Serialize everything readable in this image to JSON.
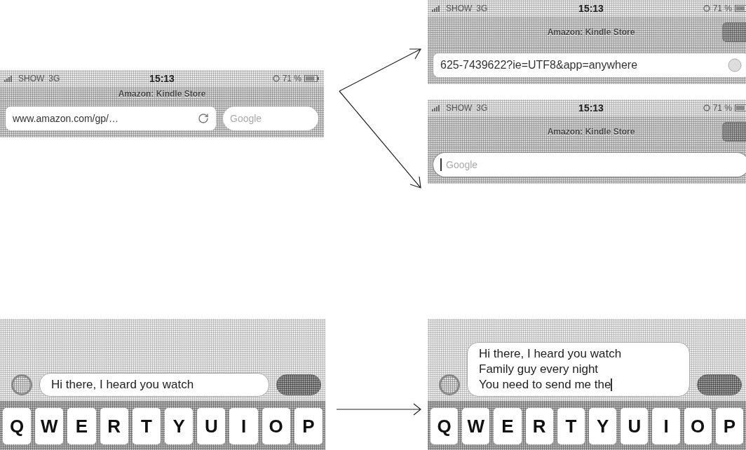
{
  "browsers": [
    {
      "kind": "split",
      "status": {
        "carrier": "SHOW",
        "network": "3G",
        "time": "15:13",
        "battery": "71 %"
      },
      "title": "Amazon: Kindle Store",
      "address": "www.amazon.com/gp/…",
      "search_placeholder": "Google",
      "search_focused": false
    },
    {
      "kind": "address",
      "status": {
        "carrier": "SHOW",
        "network": "3G",
        "time": "15:13",
        "battery": "71 %"
      },
      "title": "Amazon: Kindle Store",
      "address": "625-7439622?ie=UTF8&app=anywhere"
    },
    {
      "kind": "search",
      "status": {
        "carrier": "SHOW",
        "network": "3G",
        "time": "15:13",
        "battery": "71 %"
      },
      "title": "Amazon: Kindle Store",
      "search_placeholder": "Google",
      "search_focused": true
    }
  ],
  "composers": [
    {
      "lines": [
        "Hi there, I heard you watch"
      ],
      "cursor": false,
      "keys": [
        "Q",
        "W",
        "E",
        "R",
        "T",
        "Y",
        "U",
        "I",
        "O",
        "P"
      ]
    },
    {
      "lines": [
        "Hi there, I heard you watch",
        "Family guy every night",
        "You need to send me the"
      ],
      "cursor": true,
      "keys": [
        "Q",
        "W",
        "E",
        "R",
        "T",
        "Y",
        "U",
        "I",
        "O",
        "P"
      ]
    }
  ]
}
